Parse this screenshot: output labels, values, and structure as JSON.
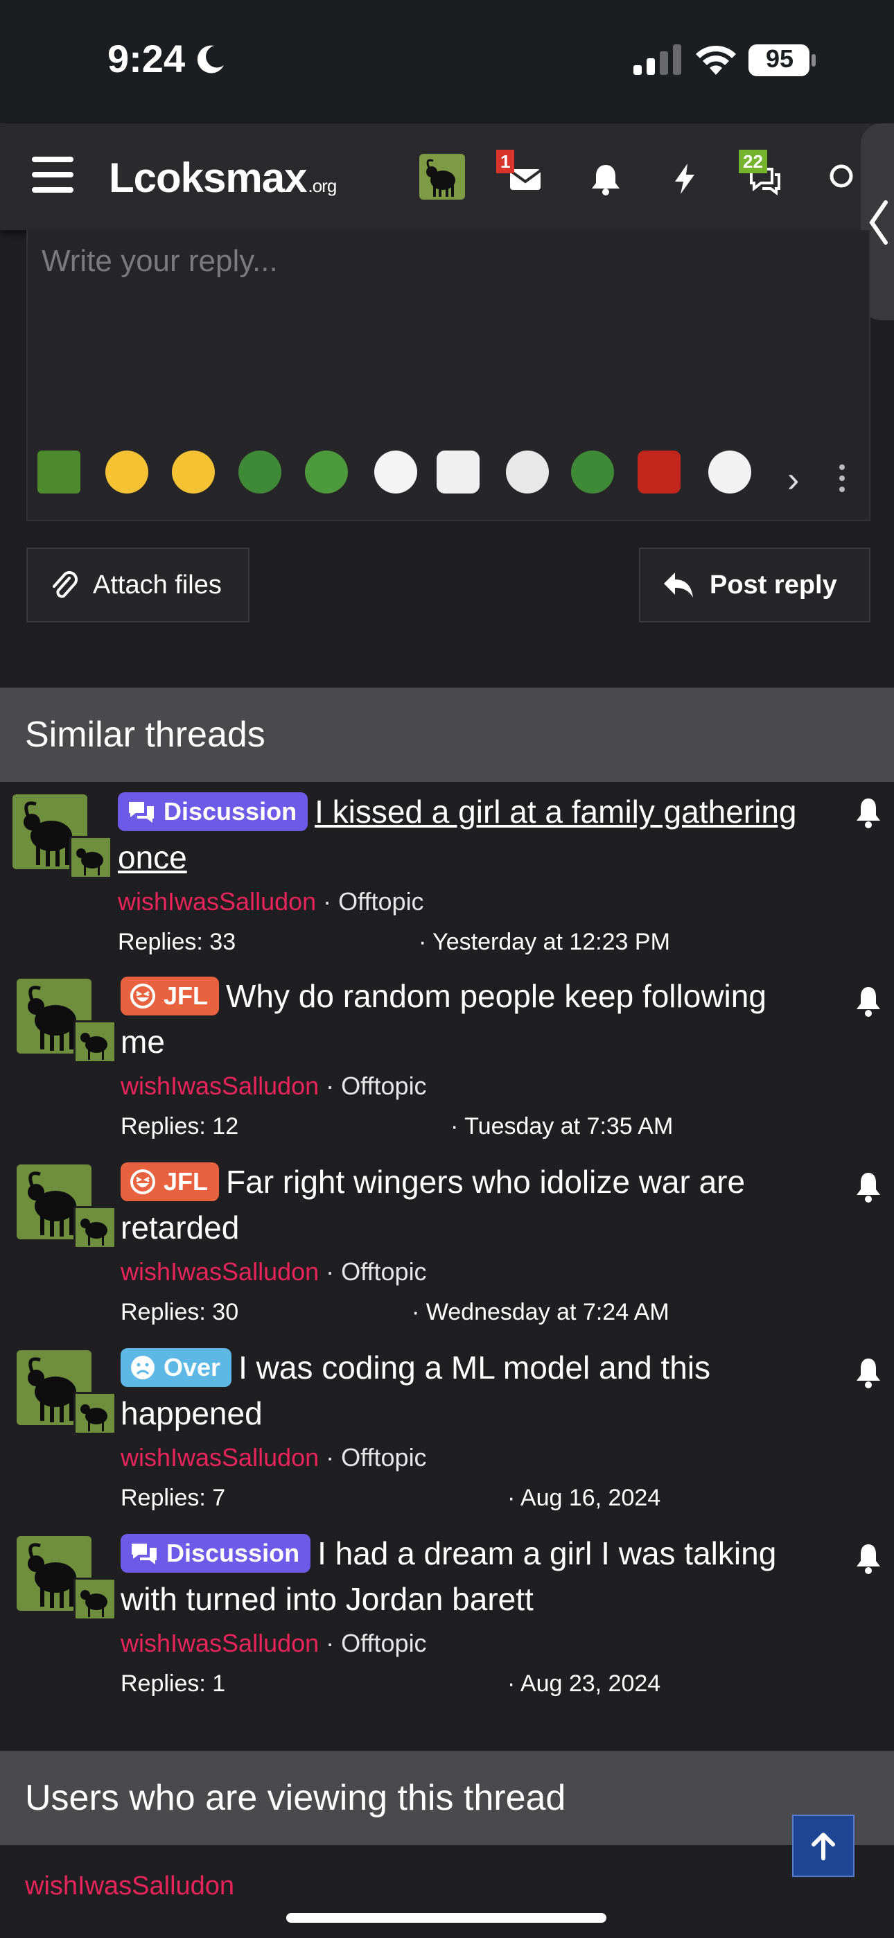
{
  "status": {
    "time": "9:24",
    "battery": "95"
  },
  "nav": {
    "logo": "Lcoksmax",
    "logo_suffix": ".org",
    "messages_badge": "1",
    "conversations_badge": "22"
  },
  "reply": {
    "placeholder": "Write your reply...",
    "attach_label": "Attach files",
    "post_label": "Post reply"
  },
  "similar": {
    "title": "Similar threads",
    "threads": [
      {
        "prefix": "Discussion",
        "title": "I kissed a girl at a family gathering once",
        "author": "wishIwasSalludon",
        "forum": "· Offtopic",
        "replies": "Replies: 33",
        "date": "· Yesterday at 12:23 PM"
      },
      {
        "prefix": "JFL",
        "title": "Why do random people keep following me",
        "author": "wishIwasSalludon",
        "forum": "· Offtopic",
        "replies": "Replies: 12",
        "date": "· Tuesday at 7:35 AM"
      },
      {
        "prefix": "JFL",
        "title": "Far right wingers who idolize war are retarded",
        "author": "wishIwasSalludon",
        "forum": "· Offtopic",
        "replies": "Replies: 30",
        "date": "· Wednesday at 7:24 AM"
      },
      {
        "prefix": "Over",
        "title": "I was coding a ML model and this happened",
        "author": "wishIwasSalludon",
        "forum": "· Offtopic",
        "replies": "Replies: 7",
        "date": "· Aug 16, 2024"
      },
      {
        "prefix": "Discussion",
        "title": "I had a dream a girl I was talking with turned into Jordan barett",
        "author": "wishIwasSalludon",
        "forum": "· Offtopic",
        "replies": "Replies: 1",
        "date": "· Aug 23, 2024"
      }
    ]
  },
  "viewers": {
    "title": "Users who are viewing this thread",
    "user": "wishIwasSalludon"
  },
  "colors": {
    "accent_author": "#e8245a",
    "discussion": "#6d5ae6",
    "jfl": "#e8623f",
    "over": "#5eb8e6"
  }
}
